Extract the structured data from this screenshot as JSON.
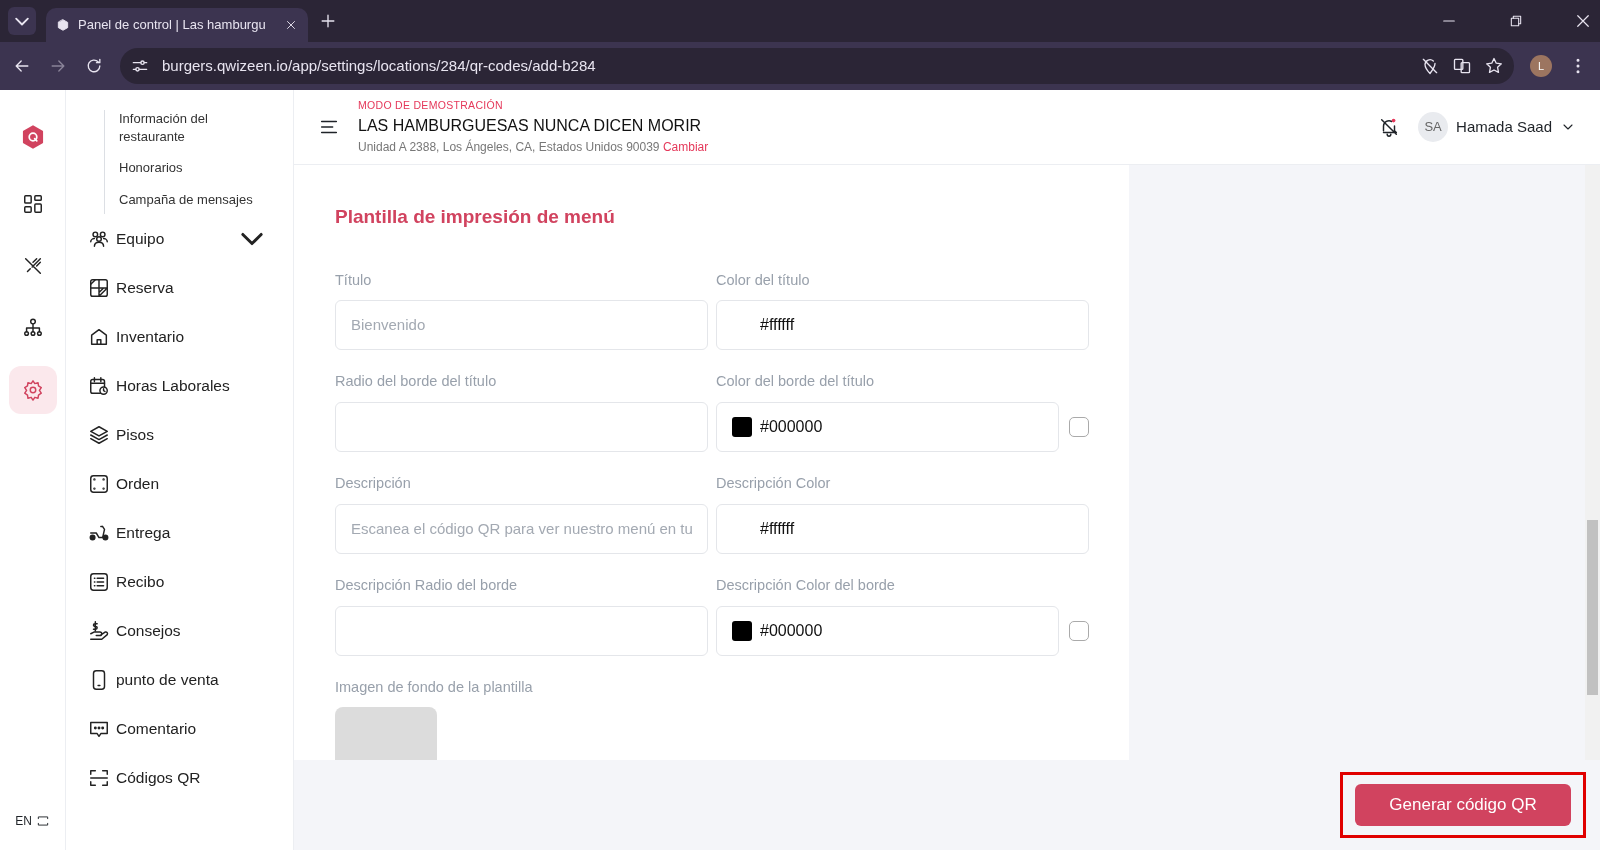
{
  "browser": {
    "tab_title": "Panel de control | Las hamburgu",
    "url": "burgers.qwizeen.io/app/settings/locations/284/qr-codes/add-b284",
    "profile_initial": "L"
  },
  "rail": {
    "items": [
      {
        "kind": "dashboard",
        "selected": false
      },
      {
        "kind": "utensils",
        "selected": false
      },
      {
        "kind": "network",
        "selected": false
      },
      {
        "kind": "settings",
        "selected": true
      }
    ],
    "language": "EN"
  },
  "sidebar": {
    "subitems": [
      "Información del restaurante",
      "Honorarios",
      "Campaña de mensajes"
    ],
    "items": [
      {
        "label": "Equipo",
        "kind": "group"
      },
      {
        "label": "Reserva",
        "kind": "link"
      },
      {
        "label": "Inventario",
        "kind": "link"
      },
      {
        "label": "Horas Laborales",
        "kind": "link"
      },
      {
        "label": "Pisos",
        "kind": "link"
      },
      {
        "label": "Orden",
        "kind": "link"
      },
      {
        "label": "Entrega",
        "kind": "link"
      },
      {
        "label": "Recibo",
        "kind": "link"
      },
      {
        "label": "Consejos",
        "kind": "link"
      },
      {
        "label": "punto de venta",
        "kind": "link"
      },
      {
        "label": "Comentario",
        "kind": "link"
      },
      {
        "label": "Códigos QR",
        "kind": "link"
      }
    ]
  },
  "header": {
    "demo_label": "MODO DE DEMOSTRACIÓN",
    "restaurant_name": "LAS HAMBURGUESAS NUNCA DICEN MORIR",
    "address": "Unidad A 2388, Los Ángeles, CA, Estados Unidos 90039",
    "change_link": "Cambiar",
    "user": {
      "initials": "SA",
      "name": "Hamada Saad"
    }
  },
  "form": {
    "title": "Plantilla de impresión de menú",
    "fields": [
      {
        "label": "Título",
        "kind": "text",
        "placeholder": "Bienvenido"
      },
      {
        "label": "Color del título",
        "kind": "color",
        "value": "#ffffff"
      },
      {
        "label": "Radio del borde del título",
        "kind": "text"
      },
      {
        "label": "Color del borde del título",
        "kind": "color",
        "value": "#000000",
        "checkbox": {
          "checked": false
        }
      },
      {
        "label": "Descripción",
        "kind": "text",
        "placeholder": "Escanea el código QR para ver nuestro menú en tu"
      },
      {
        "label": "Descripción Color",
        "kind": "color",
        "value": "#ffffff"
      },
      {
        "label": "Descripción Radio del borde",
        "kind": "text"
      },
      {
        "label": "Descripción Color del borde",
        "kind": "color",
        "value": "#000000",
        "checkbox": {
          "checked": false
        }
      }
    ],
    "image_label": "Imagen de fondo de la plantilla"
  },
  "submit": {
    "label": "Generar código QR",
    "highlighted": true
  }
}
